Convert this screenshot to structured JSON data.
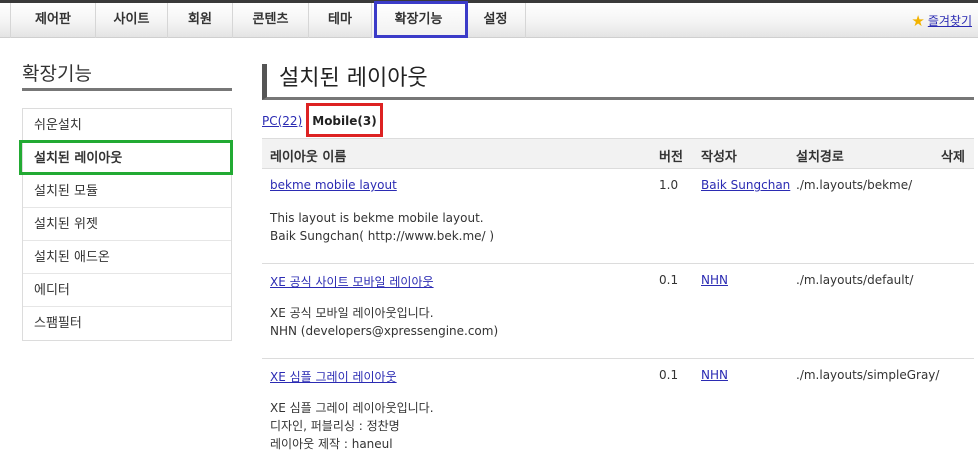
{
  "top_menu": {
    "items": [
      "제어판",
      "사이트",
      "회원",
      "콘텐츠",
      "테마",
      "확장기능",
      "설정"
    ],
    "favorites_label": "즐겨찾기"
  },
  "sidebar": {
    "title": "확장기능",
    "items": [
      "쉬운설치",
      "설치된 레이아웃",
      "설치된 모듈",
      "설치된 위젯",
      "설치된 애드온",
      "에디터",
      "스팸필터"
    ]
  },
  "main": {
    "title": "설치된 레이아웃",
    "tabs": {
      "pc": "PC(22)",
      "mobile": "Mobile(3)"
    },
    "columns": [
      "레이아웃 이름",
      "버전",
      "작성자",
      "설치경로",
      "삭제"
    ],
    "rows": [
      {
        "name": "bekme mobile layout",
        "version": "1.0",
        "author": "Baik Sungchan",
        "path": "./m.layouts/bekme/",
        "desc": [
          "This layout is bekme mobile layout.",
          "Baik Sungchan( http://www.bek.me/ )"
        ]
      },
      {
        "name": "XE 공식 사이트 모바일 레이아웃",
        "version": "0.1",
        "author": "NHN",
        "path": "./m.layouts/default/",
        "desc": [
          "XE 공식 모바일 레이아웃입니다.",
          "NHN (developers@xpressengine.com)"
        ]
      },
      {
        "name": "XE 심플 그레이 레이아웃",
        "version": "0.1",
        "author": "NHN",
        "path": "./m.layouts/simpleGray/",
        "desc": [
          "XE 심플 그레이 레이아웃입니다.",
          "디자인, 퍼블리싱 : 정찬명",
          "레이아웃 제작 : haneul"
        ]
      }
    ]
  },
  "colors": {
    "highlight_blue": "#3b3bc8",
    "highlight_green": "#22aa33",
    "highlight_red": "#dd2222",
    "link": "#2b2bb3"
  }
}
